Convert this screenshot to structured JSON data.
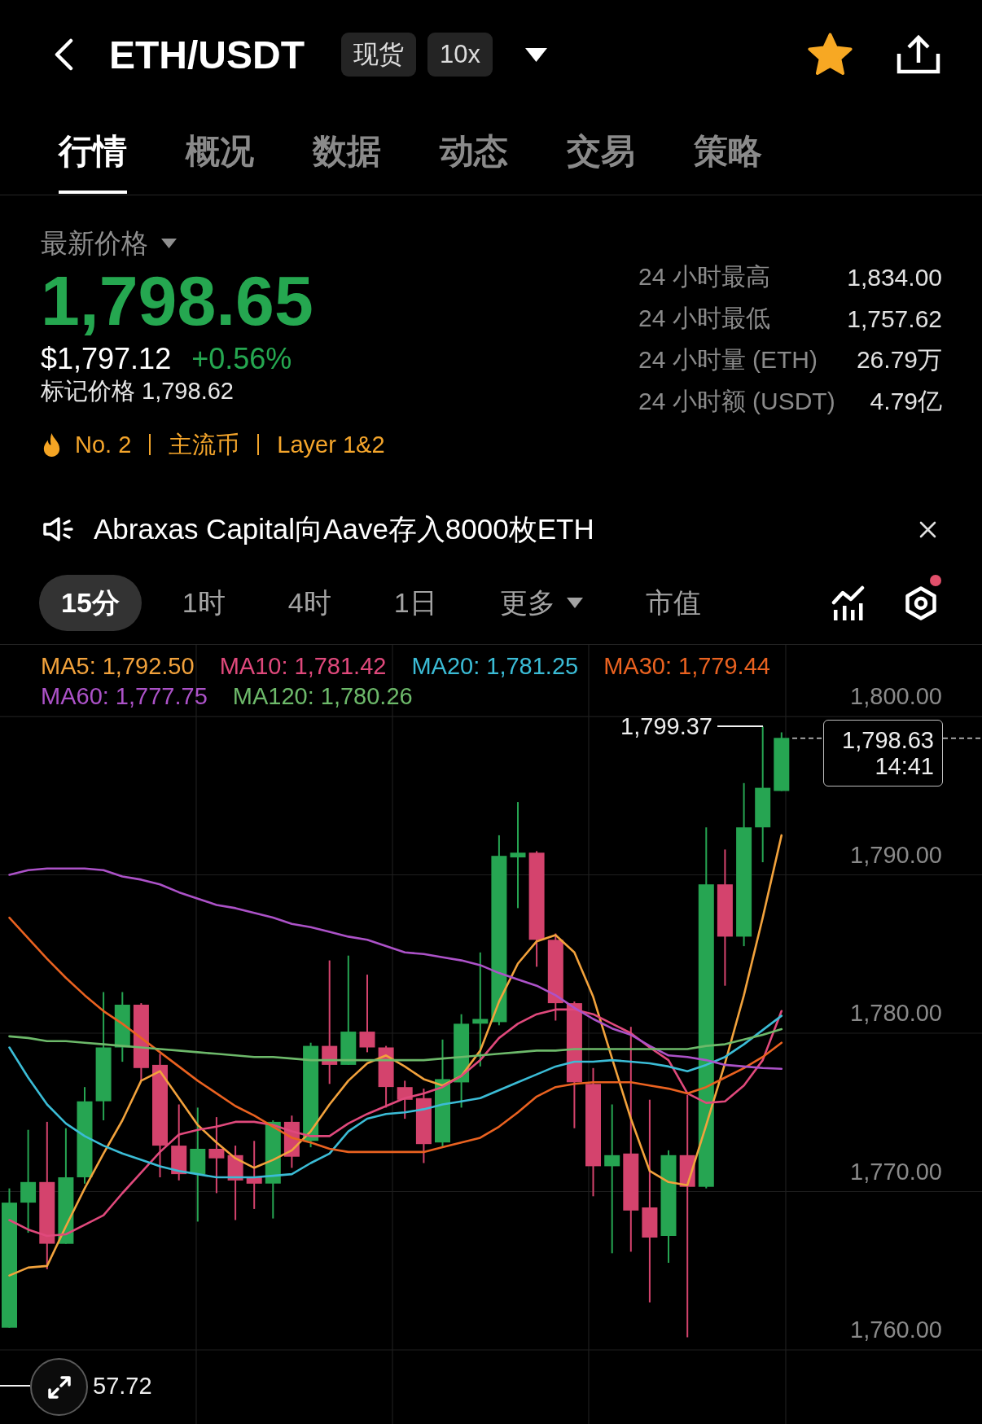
{
  "header": {
    "title": "ETH/USDT",
    "badges": [
      "现货",
      "10x"
    ],
    "favorite": true
  },
  "tabs": [
    {
      "label": "行情",
      "selected": true
    },
    {
      "label": "概况",
      "selected": false
    },
    {
      "label": "数据",
      "selected": false
    },
    {
      "label": "动态",
      "selected": false
    },
    {
      "label": "交易",
      "selected": false
    },
    {
      "label": "策略",
      "selected": false
    }
  ],
  "price": {
    "label": "最新价格",
    "last": "1,798.65",
    "usd": "$1,797.12",
    "change": "+0.56%",
    "rising": true,
    "mark_price": "标记价格 1,798.62"
  },
  "tags": [
    {
      "kind": "rank",
      "text": "No. 2"
    },
    {
      "kind": "category",
      "text": "主流币"
    },
    {
      "kind": "category",
      "text": "Layer 1&2"
    }
  ],
  "stats": [
    {
      "label": "24 小时最高",
      "value": "1,834.00"
    },
    {
      "label": "24 小时最低",
      "value": "1,757.62"
    },
    {
      "label": "24 小时量 (ETH)",
      "value": "26.79万"
    },
    {
      "label": "24 小时额 (USDT)",
      "value": "4.79亿"
    }
  ],
  "announcement": {
    "text": "Abraxas Capital向Aave存入8000枚ETH"
  },
  "intervals": [
    {
      "kind": "interval",
      "label": "15分",
      "selected": true
    },
    {
      "kind": "interval",
      "label": "1时",
      "selected": false
    },
    {
      "kind": "interval",
      "label": "4时",
      "selected": false
    },
    {
      "kind": "interval",
      "label": "1日",
      "selected": false
    },
    {
      "kind": "dropdown",
      "label": "更多",
      "selected": false
    },
    {
      "kind": "interval",
      "label": "市值",
      "selected": false
    }
  ],
  "chart_tools": [
    {
      "kind": "indicators",
      "dot": false
    },
    {
      "kind": "settings",
      "dot": true
    }
  ],
  "chart": {
    "chart_data": {
      "type": "line",
      "grid": true,
      "ylim": [
        1755.32,
        1804.58
      ],
      "yticks": [
        {
          "value": 1800,
          "label": "1,800.00"
        },
        {
          "value": 1790,
          "label": "1,790.00"
        },
        {
          "value": 1780,
          "label": "1,780.00"
        },
        {
          "value": 1770,
          "label": "1,770.00"
        },
        {
          "value": 1760,
          "label": "1,760.00"
        }
      ],
      "series": [
        {
          "name": "MA5: 1,792.50",
          "color": "#f2a23c",
          "values": [
            1764.7,
            1765.2,
            1765.3,
            1767.8,
            1770.2,
            1772.4,
            1774.5,
            1777.0,
            1777.6,
            1775.9,
            1774.2,
            1773.1,
            1772.1,
            1771.5,
            1772.0,
            1772.6,
            1773.8,
            1775.5,
            1777.0,
            1778.1,
            1778.6,
            1777.9,
            1777.1,
            1776.7,
            1777.3,
            1778.9,
            1782.0,
            1784.4,
            1785.8,
            1786.2,
            1785.1,
            1782.3,
            1778.4,
            1774.6,
            1771.3,
            1770.6,
            1770.4,
            1774.2,
            1778.1,
            1782.4,
            1787.3,
            1792.5
          ]
        },
        {
          "name": "MA10: 1,781.42",
          "color": "#e0497c",
          "values": [
            1768.2,
            1767.6,
            1767.2,
            1767.3,
            1767.9,
            1768.5,
            1769.9,
            1771.2,
            1772.5,
            1773.6,
            1773.9,
            1774.1,
            1774.4,
            1774.4,
            1774.2,
            1773.8,
            1773.5,
            1773.5,
            1774.3,
            1774.9,
            1775.4,
            1775.9,
            1776.2,
            1776.6,
            1777.3,
            1778.3,
            1779.7,
            1780.6,
            1781.2,
            1781.5,
            1781.5,
            1781.2,
            1780.6,
            1780.0,
            1779.1,
            1778.3,
            1776.2,
            1775.6,
            1775.7,
            1776.7,
            1778.3,
            1781.4
          ]
        },
        {
          "name": "MA20: 1,781.25",
          "color": "#3bbcd6",
          "values": [
            1779.1,
            1777.2,
            1775.5,
            1774.3,
            1773.5,
            1772.9,
            1772.4,
            1772.0,
            1771.6,
            1771.3,
            1771.1,
            1770.9,
            1770.9,
            1770.9,
            1771.0,
            1771.1,
            1771.8,
            1772.4,
            1773.8,
            1774.6,
            1774.9,
            1775.0,
            1775.2,
            1775.5,
            1775.7,
            1775.9,
            1776.4,
            1776.9,
            1777.4,
            1777.9,
            1778.2,
            1778.2,
            1778.3,
            1778.2,
            1778.1,
            1777.9,
            1777.6,
            1778.0,
            1778.5,
            1779.3,
            1780.2,
            1781.1
          ]
        },
        {
          "name": "MA30: 1,779.44",
          "color": "#ea6220",
          "values": [
            1787.3,
            1786.0,
            1784.7,
            1783.5,
            1782.4,
            1781.4,
            1780.6,
            1779.7,
            1778.8,
            1777.9,
            1777.0,
            1776.2,
            1775.4,
            1774.8,
            1774.1,
            1773.4,
            1773.1,
            1772.7,
            1772.5,
            1772.5,
            1772.5,
            1772.5,
            1772.5,
            1772.8,
            1773.1,
            1773.4,
            1774.1,
            1775.0,
            1776.0,
            1776.6,
            1776.8,
            1776.9,
            1776.9,
            1776.9,
            1776.7,
            1776.5,
            1776.2,
            1776.6,
            1777.2,
            1777.8,
            1778.5,
            1779.4
          ]
        },
        {
          "name": "MA60: 1,777.75",
          "color": "#ac52c8",
          "values": [
            1790.0,
            1790.3,
            1790.4,
            1790.4,
            1790.4,
            1790.3,
            1789.9,
            1789.7,
            1789.4,
            1788.9,
            1788.5,
            1788.1,
            1787.9,
            1787.6,
            1787.3,
            1786.9,
            1786.7,
            1786.4,
            1786.1,
            1785.9,
            1785.5,
            1785.1,
            1785.0,
            1784.8,
            1784.6,
            1784.3,
            1783.8,
            1783.4,
            1783.0,
            1782.4,
            1781.6,
            1780.9,
            1780.3,
            1779.9,
            1779.2,
            1778.6,
            1778.5,
            1778.3,
            1778.0,
            1777.9,
            1777.8,
            1777.75
          ]
        },
        {
          "name": "MA120: 1,780.26",
          "color": "#6db96a",
          "values": [
            1779.8,
            1779.7,
            1779.5,
            1779.5,
            1779.4,
            1779.3,
            1779.2,
            1779.1,
            1779.0,
            1778.9,
            1778.8,
            1778.7,
            1778.6,
            1778.5,
            1778.5,
            1778.4,
            1778.3,
            1778.3,
            1778.3,
            1778.3,
            1778.3,
            1778.3,
            1778.3,
            1778.4,
            1778.5,
            1778.6,
            1778.7,
            1778.8,
            1778.9,
            1778.9,
            1779.0,
            1779.0,
            1779.0,
            1779.0,
            1779.0,
            1779.0,
            1779.0,
            1779.2,
            1779.3,
            1779.6,
            1779.9,
            1780.26
          ]
        }
      ]
    },
    "high_label": "1,799.37",
    "last_price": "1,798.63",
    "countdown": "14:41",
    "low_label": "57.72"
  }
}
